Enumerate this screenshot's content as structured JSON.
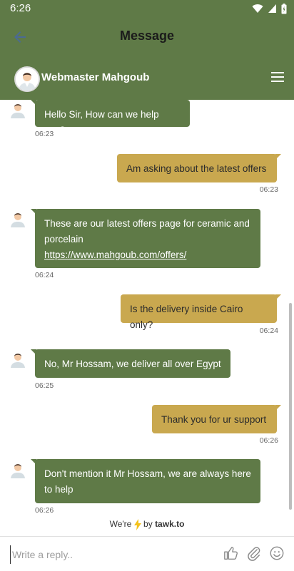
{
  "status": {
    "time": "6:26"
  },
  "appbar": {
    "title": "Message"
  },
  "chat": {
    "agent_name": "Webmaster Mahgoub"
  },
  "messages": [
    {
      "from": "agent",
      "text": "Hello Sir, How can we help you?",
      "time": "06:23"
    },
    {
      "from": "user",
      "text": "Am asking about the latest offers",
      "time": "06:23"
    },
    {
      "from": "agent",
      "text": "These are our latest offers page for ceramic and porcelain",
      "link": "https://www.mahgoub.com/offers/",
      "time": "06:24"
    },
    {
      "from": "user",
      "text": "Is the delivery inside Cairo only?",
      "time": "06:24"
    },
    {
      "from": "agent",
      "text": "No, Mr Hossam, we deliver all over Egypt",
      "time": "06:25"
    },
    {
      "from": "user",
      "text": "Thank you for ur support",
      "time": "06:26"
    },
    {
      "from": "agent",
      "text": "Don't mention it Mr Hossam, we are always here to help",
      "time": "06:26"
    }
  ],
  "footer": {
    "powered_prefix": "We're",
    "powered_by": "by",
    "brand": "tawk.to",
    "input_placeholder": "Write a reply.."
  },
  "colors": {
    "primary": "#5f7a47",
    "user_bubble": "#c9a84f"
  }
}
